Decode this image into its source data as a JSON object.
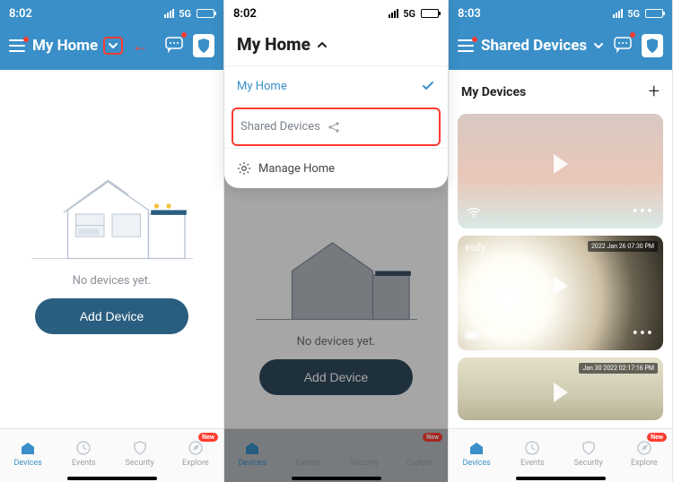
{
  "status": {
    "time1": "8:02",
    "time2": "8:02",
    "time3": "8:03",
    "network": "5G"
  },
  "screen1": {
    "title": "My Home",
    "empty_text": "No devices yet.",
    "add_button": "Add Device"
  },
  "screen2": {
    "panel_title": "My Home",
    "menu": {
      "my_home": "My Home",
      "shared_devices": "Shared Devices",
      "manage_home": "Manage Home"
    },
    "bg_empty_text": "No devices yet.",
    "bg_add_button": "Add Device"
  },
  "screen3": {
    "title": "Shared Devices",
    "section": "My Devices",
    "cards": [
      {
        "timestamp": "",
        "brand": ""
      },
      {
        "timestamp": "2022 Jan 26  07:30 PM",
        "brand": "eufy"
      },
      {
        "timestamp": "Jan 30 2022  02:17:16 PM",
        "brand": ""
      }
    ]
  },
  "tabs": {
    "devices": "Devices",
    "events": "Events",
    "security": "Security",
    "explore": "Explore",
    "new_badge": "New"
  }
}
